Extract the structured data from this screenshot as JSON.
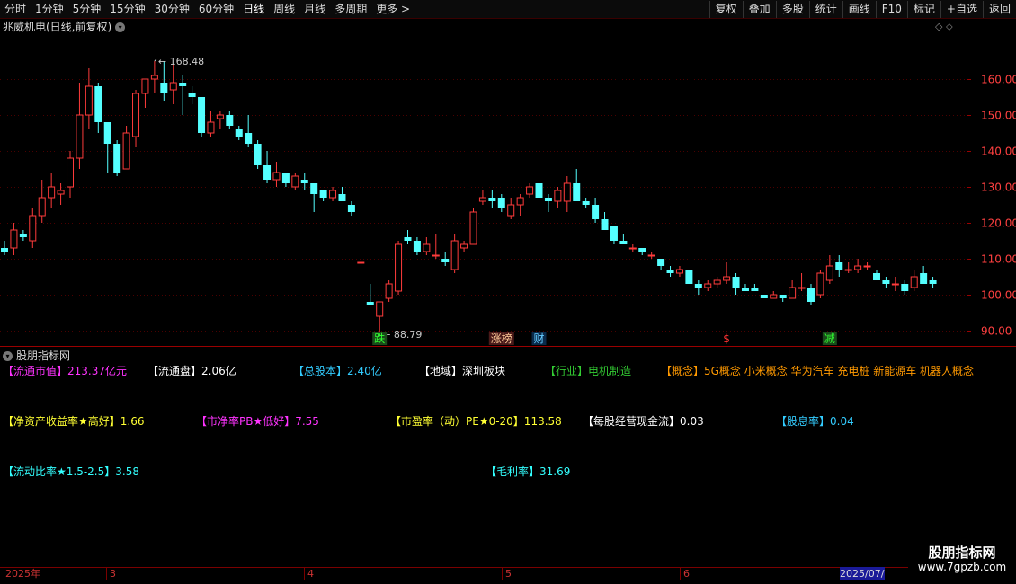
{
  "toolbar": {
    "periods": [
      "分时",
      "1分钟",
      "5分钟",
      "15分钟",
      "30分钟",
      "60分钟",
      "日线",
      "周线",
      "月线",
      "多周期",
      "更多 >"
    ],
    "active_period": "日线",
    "buttons": [
      "复权",
      "叠加",
      "多股",
      "统计",
      "画线",
      "F10",
      "标记",
      "+自选",
      "返回"
    ]
  },
  "chart_title": "兆威机电(日线,前复权)",
  "chart_data": {
    "type": "candlestick",
    "ylim": [
      86,
      172
    ],
    "yticks": [
      90,
      100,
      110,
      120,
      130,
      140,
      150,
      160
    ],
    "annotations": {
      "high": "168.48",
      "low": "88.79"
    },
    "candles": [
      [
        113,
        115,
        111,
        112
      ],
      [
        113,
        120,
        111,
        118
      ],
      [
        117,
        118,
        115,
        116
      ],
      [
        115,
        124,
        113,
        122
      ],
      [
        122,
        132,
        120,
        127
      ],
      [
        127,
        134,
        124,
        130
      ],
      [
        128,
        131,
        125,
        129
      ],
      [
        130,
        140,
        127,
        138
      ],
      [
        138,
        159,
        135,
        150
      ],
      [
        150,
        163,
        146,
        158
      ],
      [
        158,
        159,
        145,
        148
      ],
      [
        148,
        148,
        134,
        142
      ],
      [
        142,
        143,
        133,
        134
      ],
      [
        135,
        147,
        135,
        145
      ],
      [
        144,
        157,
        141,
        156
      ],
      [
        156,
        160,
        152,
        160
      ],
      [
        160,
        165,
        156,
        161
      ],
      [
        159,
        165,
        154,
        156
      ],
      [
        157,
        164,
        153,
        159
      ],
      [
        159,
        161,
        150,
        158
      ],
      [
        156,
        158,
        153,
        155
      ],
      [
        155,
        155,
        144,
        145
      ],
      [
        145,
        151,
        144,
        148
      ],
      [
        149,
        151,
        146,
        150
      ],
      [
        150,
        151,
        146,
        147
      ],
      [
        146,
        147,
        143,
        144
      ],
      [
        145,
        150,
        141,
        142
      ],
      [
        142,
        143,
        135,
        136
      ],
      [
        136,
        140,
        131,
        132
      ],
      [
        132,
        137,
        130,
        134
      ],
      [
        134,
        134,
        130,
        131
      ],
      [
        130,
        134,
        129,
        133
      ],
      [
        132,
        134,
        129,
        131
      ],
      [
        131,
        131,
        123,
        128
      ],
      [
        129,
        129,
        126,
        127
      ],
      [
        127,
        130,
        126,
        129
      ],
      [
        128,
        130,
        126,
        126
      ],
      [
        125,
        126,
        122,
        123
      ],
      [
        109,
        109,
        109,
        109
      ],
      [
        98,
        103,
        97,
        97
      ],
      [
        94,
        98,
        89,
        98
      ],
      [
        99,
        104,
        98,
        103
      ],
      [
        101,
        115,
        100,
        114
      ],
      [
        116,
        118,
        114,
        115
      ],
      [
        115,
        116,
        111,
        112
      ],
      [
        112,
        116,
        111,
        114
      ],
      [
        111,
        117,
        110,
        111
      ],
      [
        110,
        112,
        108,
        109
      ],
      [
        107,
        117,
        106,
        115
      ],
      [
        113,
        115,
        112,
        114
      ],
      [
        114,
        124,
        114,
        123
      ],
      [
        126,
        129,
        125,
        127
      ],
      [
        127,
        129,
        124,
        126
      ],
      [
        127,
        128,
        123,
        124
      ],
      [
        122,
        127,
        121,
        125
      ],
      [
        125,
        128,
        122,
        127
      ],
      [
        128,
        131,
        127,
        130
      ],
      [
        131,
        132,
        126,
        127
      ],
      [
        127,
        128,
        123,
        126
      ],
      [
        126,
        130,
        124,
        129
      ],
      [
        126,
        133,
        123,
        131
      ],
      [
        131,
        135,
        126,
        126
      ],
      [
        126,
        127,
        124,
        125
      ],
      [
        125,
        127,
        120,
        121
      ],
      [
        121,
        123,
        118,
        118
      ],
      [
        119,
        119,
        114,
        115
      ],
      [
        115,
        117,
        114,
        114
      ],
      [
        113,
        114,
        112,
        113
      ],
      [
        113,
        113,
        111,
        112
      ],
      [
        111,
        112,
        110,
        111
      ],
      [
        110,
        110,
        107,
        108
      ],
      [
        107,
        108,
        105,
        106
      ],
      [
        106,
        108,
        105,
        107
      ],
      [
        107,
        107,
        103,
        103
      ],
      [
        103,
        104,
        100,
        102
      ],
      [
        102,
        104,
        101,
        103
      ],
      [
        103,
        105,
        102,
        104
      ],
      [
        104,
        109,
        103,
        105
      ],
      [
        105,
        106,
        100,
        102
      ],
      [
        102,
        103,
        101,
        101
      ],
      [
        102,
        103,
        101,
        101
      ],
      [
        100,
        100,
        99,
        99
      ],
      [
        99,
        101,
        99,
        100
      ],
      [
        100,
        100,
        98,
        99
      ],
      [
        99,
        104,
        99,
        102
      ],
      [
        102,
        106,
        101,
        102
      ],
      [
        102,
        103,
        97,
        98
      ],
      [
        100,
        107,
        99,
        106
      ],
      [
        104,
        111,
        103,
        108
      ],
      [
        109,
        111,
        105,
        107
      ],
      [
        107,
        109,
        106,
        107
      ],
      [
        107,
        110,
        106,
        108
      ],
      [
        108,
        109,
        107,
        108
      ],
      [
        106,
        107,
        104,
        104
      ],
      [
        104,
        105,
        102,
        103
      ],
      [
        103,
        105,
        101,
        103
      ],
      [
        103,
        104,
        100,
        101
      ],
      [
        102,
        107,
        101,
        105
      ],
      [
        106,
        108,
        103,
        103
      ],
      [
        104,
        105,
        102,
        103
      ]
    ],
    "markers": [
      {
        "label": "跌",
        "candle": 40,
        "color": "#33ff33",
        "bg": "#1a4a1a"
      },
      {
        "label": "涨榜",
        "candle": 53,
        "color": "#ffcc99",
        "bg": "#4a1a1a"
      },
      {
        "label": "财",
        "candle": 57,
        "color": "#66ccff",
        "bg": "#0a2a4a"
      },
      {
        "label": "$",
        "candle": 77,
        "color": "#ff3333",
        "bg": ""
      },
      {
        "label": "减",
        "candle": 88,
        "color": "#33ff33",
        "bg": "#1a4a1a"
      }
    ],
    "colors": {
      "up": "#ff3b3b",
      "down": "#54ffff",
      "grid": "#4a0000",
      "axis": "#9a0000"
    }
  },
  "indicator_title": "股朋指标网",
  "info": {
    "market_cap": "【流通市值】213.37亿元",
    "float_shares": "【流通盘】2.06亿",
    "total_shares": "【总股本】2.40亿",
    "region": "【地域】深圳板块",
    "industry": "【行业】电机制造",
    "concepts": "【概念】5G概念 小米概念 华为汽车 充电桩 新能源车 机器人概念",
    "roe": "【净资产收益率★高好】1.66",
    "pb": "【市净率PB★低好】7.55",
    "pe": "【市盈率（动）PE★0-20】113.58",
    "ocf": "【每股经营现金流】0.03",
    "dividend": "【股息率】0.04",
    "current_ratio": "【流动比率★1.5-2.5】3.58",
    "gross_margin": "【毛利率】31.69"
  },
  "timeline": {
    "labels": [
      "2025年",
      "3",
      "4",
      "5",
      "6"
    ],
    "end_label": "2025/07/"
  },
  "watermark": {
    "title": "股朋指标网",
    "url": "www.7gpzb.com"
  }
}
